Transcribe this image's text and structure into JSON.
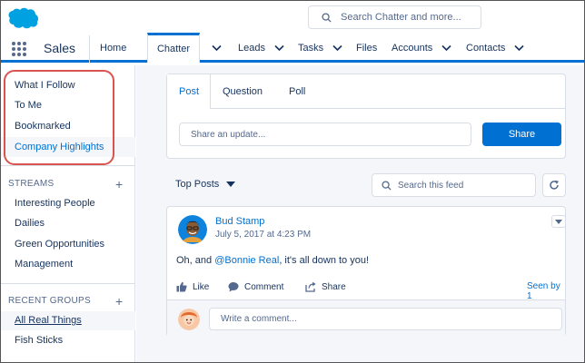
{
  "header": {
    "search_placeholder": "Search Chatter and more..."
  },
  "nav": {
    "app_name": "Sales",
    "items": [
      {
        "label": "Home"
      },
      {
        "label": "Chatter"
      },
      {
        "label": "Leads"
      },
      {
        "label": "Tasks"
      },
      {
        "label": "Files"
      },
      {
        "label": "Accounts"
      },
      {
        "label": "Contacts"
      }
    ]
  },
  "sidebar": {
    "feeds": [
      {
        "label": "What I Follow"
      },
      {
        "label": "To Me"
      },
      {
        "label": "Bookmarked"
      },
      {
        "label": "Company Highlights"
      }
    ],
    "streams_heading": "STREAMS",
    "streams": [
      {
        "label": "Interesting People"
      },
      {
        "label": "Dailies"
      },
      {
        "label": "Green Opportunities"
      },
      {
        "label": "Management"
      }
    ],
    "groups_heading": "RECENT GROUPS",
    "groups": [
      {
        "label": "All Real Things"
      },
      {
        "label": "Fish Sticks"
      }
    ]
  },
  "publisher": {
    "tabs": [
      {
        "label": "Post"
      },
      {
        "label": "Question"
      },
      {
        "label": "Poll"
      }
    ],
    "input_placeholder": "Share an update...",
    "share_label": "Share"
  },
  "feed": {
    "sort_label": "Top Posts",
    "search_placeholder": "Search this feed"
  },
  "post": {
    "author": "Bud Stamp",
    "timestamp": "July 5, 2017 at 4:23 PM",
    "body_prefix": "Oh, and ",
    "mention": "@Bonnie Real",
    "body_suffix": ", it's all down to you!",
    "like_label": "Like",
    "comment_label": "Comment",
    "share_label": "Share",
    "seen_by_label": "Seen by 1",
    "comment_placeholder": "Write a comment..."
  },
  "colors": {
    "brand": "#0070d2",
    "highlight_ring": "#d9534f"
  }
}
